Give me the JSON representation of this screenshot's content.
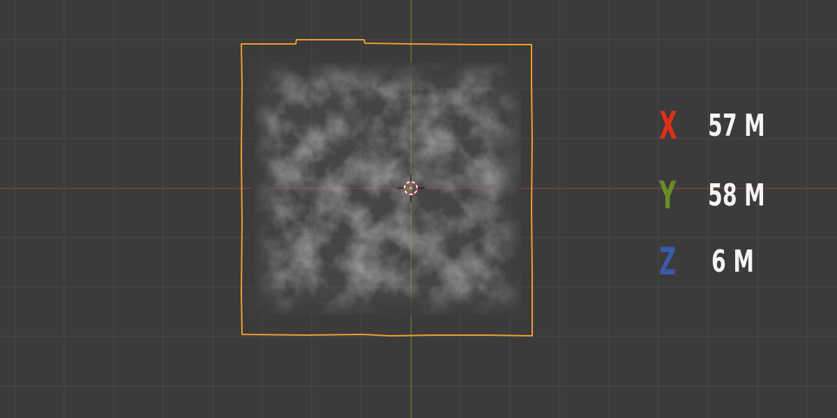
{
  "viewport": {
    "background_color": "#3b3b3b",
    "grid_color": "#4a4a4a",
    "x_axis_color": "#9c3b3b",
    "y_axis_color": "#6b8a2a",
    "selection_outline_color": "#f0a030",
    "object": "smoke-volume"
  },
  "dimensions": {
    "x": {
      "axis": "X",
      "value": "57 M",
      "color": "#e0301a"
    },
    "y": {
      "axis": "Y",
      "value": "58 M",
      "color": "#6a8c26"
    },
    "z": {
      "axis": "Z",
      "value": "6 M",
      "color": "#3a5aa8"
    }
  },
  "cursor": {
    "icon": "3d-cursor-icon"
  }
}
